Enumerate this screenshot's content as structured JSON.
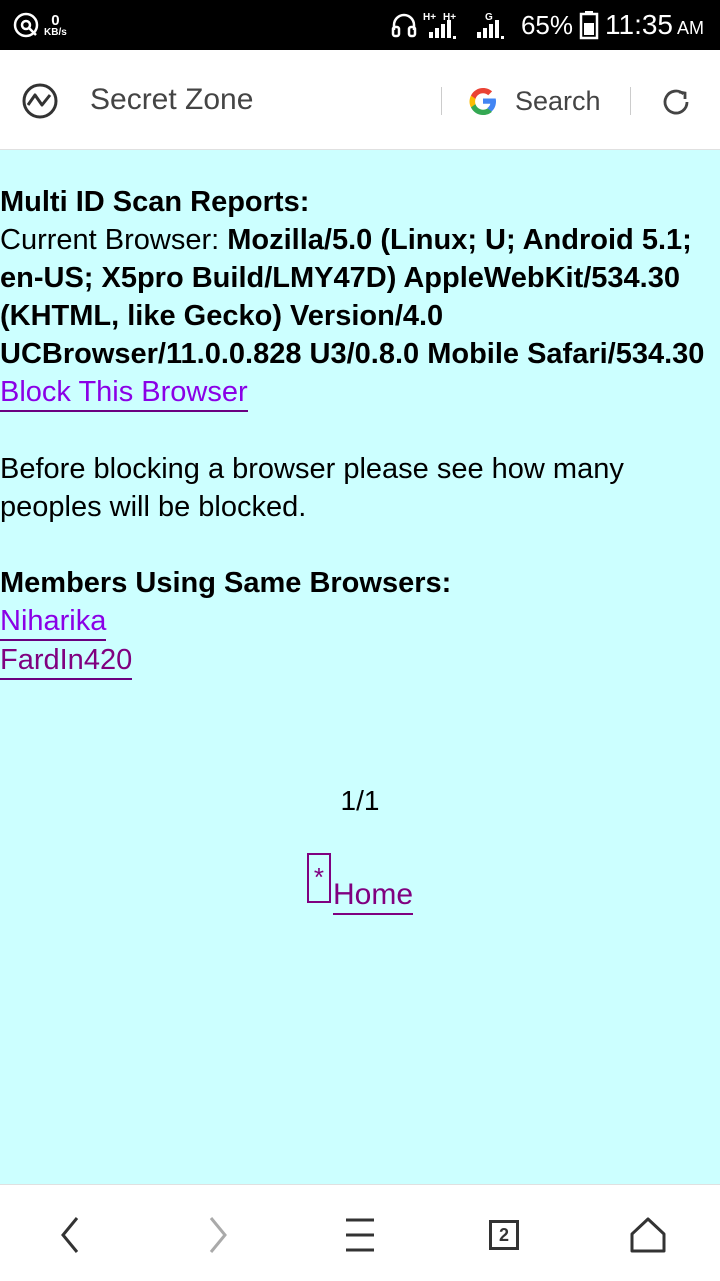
{
  "status_bar": {
    "speed_value": "0",
    "speed_unit": "KB/s",
    "network_1": "H+",
    "network_2": "H+",
    "network_3": "G",
    "battery_percent": "65%",
    "time": "11:35",
    "ampm": "AM"
  },
  "address_bar": {
    "site_title": "Secret Zone",
    "search_label": "Search"
  },
  "content": {
    "heading": "Multi ID Scan Reports:",
    "current_browser_label": "Current Browser: ",
    "user_agent": "Mozilla/5.0 (Linux; U; Android 5.1; en-US; X5pro Build/LMY47D) AppleWebKit/534.30 (KHTML, like Gecko) Version/4.0 UCBrowser/11.0.0.828 U3/0.8.0 Mobile Safari/534.30",
    "block_link": "Block This Browser",
    "notice": "Before blocking a browser please see how many peoples will be blocked.",
    "members_heading": "Members Using Same Browsers:",
    "members": [
      "Niharika",
      "FardIn420"
    ],
    "pager": "1/1",
    "home_star": "*",
    "home_link": "Home"
  },
  "bottom_nav": {
    "tab_count": "2"
  }
}
